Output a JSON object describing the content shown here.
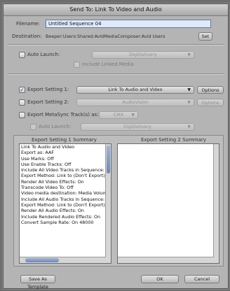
{
  "window": {
    "title": "Send To: Link To Video and Audio"
  },
  "filename": {
    "label": "Filename:",
    "value": "Untitled Sequence 04"
  },
  "destination": {
    "label": "Destination:",
    "value": "Beeper:Users:Shared:AvidMediaComposer:Avid Users",
    "set_button": "Set"
  },
  "auto_launch": {
    "label": "Auto Launch:",
    "popup": "DigiDelivery",
    "include_media": "Include Linked Media"
  },
  "export_setting_1": {
    "label": "Export Setting 1:",
    "popup": "Link To Audio and Video",
    "checked": true,
    "options_button": "Options"
  },
  "export_setting_2": {
    "label": "Export Setting 2:",
    "popup": "AudioVision",
    "checked": false,
    "options_button": "Options"
  },
  "metasync": {
    "label": "Export MetaSync Track(s) as:",
    "popup": "CMX"
  },
  "auto_launch_2": {
    "label": "Auto Launch:",
    "popup": "DigiDelivery"
  },
  "summary1": {
    "title": "Export Setting 1 Summary",
    "lines": [
      "Link To Audio and Video",
      "Export as: AAF",
      "Use Marks: Off",
      "Use Enable Tracks: Off",
      "Include All Video Tracks in Sequence: On",
      "Export Method: Link to (Don't Export) Me",
      "Render All Video Effects: On",
      "Transcode Video To: Off",
      "Video media destination: Media Volume (U",
      "Include All Audio Tracks in Sequence: On",
      "Export Method: Link to (Don't Export) Me",
      "Render All Audio Effects: On",
      "Include Rendered Audio Effects: On",
      "Convert Sample Rate: On  48000"
    ]
  },
  "summary2": {
    "title": "Export Setting 2 Summary",
    "lines": []
  },
  "footer": {
    "save_template": "Save As Template",
    "ok": "OK",
    "cancel": "Cancel"
  }
}
